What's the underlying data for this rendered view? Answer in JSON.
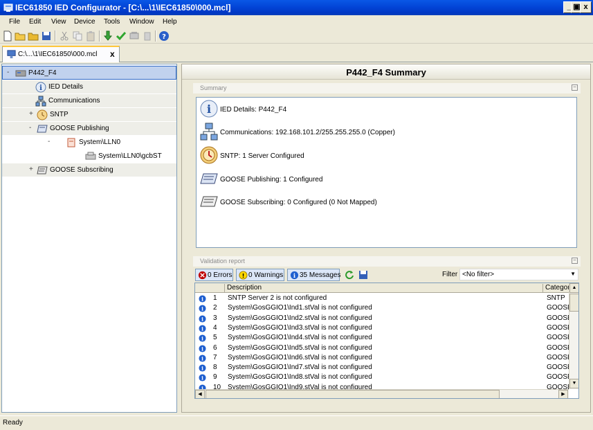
{
  "window": {
    "title": "IEC61850 IED Configurator - [C:\\...\\1\\IEC61850\\000.mcl]",
    "minimize": "_",
    "maximize": "ё",
    "close": "x"
  },
  "menu": [
    "File",
    "Edit",
    "View",
    "Device",
    "Tools",
    "Window",
    "Help"
  ],
  "toolbar_icons": [
    "new-icon",
    "open-icon",
    "folder-icon",
    "save-icon",
    "cut-icon",
    "copy-icon",
    "paste-icon",
    "download-icon",
    "check-icon",
    "send-icon",
    "receive-icon",
    "help-icon"
  ],
  "document_tab": {
    "label": "C:\\...\\1\\IEC61850\\000.mcl",
    "close": "x"
  },
  "tree": {
    "items": [
      {
        "label": "P442_F4",
        "expander": "-",
        "icon": "ied-icon"
      },
      {
        "label": "IED Details",
        "expander": "",
        "icon": "info-icon"
      },
      {
        "label": "Communications",
        "expander": "",
        "icon": "network-icon"
      },
      {
        "label": "SNTP",
        "expander": "+",
        "icon": "clock-icon"
      },
      {
        "label": "GOOSE Publishing",
        "expander": "-",
        "icon": "goose-pub-icon"
      },
      {
        "label": "System\\LLN0",
        "expander": "-",
        "icon": "dataset-icon"
      },
      {
        "label": "System\\LLN0\\gcbST",
        "expander": "",
        "icon": "gcb-icon"
      },
      {
        "label": "GOOSE Subscribing",
        "expander": "+",
        "icon": "goose-sub-icon"
      }
    ]
  },
  "summary": {
    "title": "P442_F4 Summary",
    "group_label": "Summary",
    "collapse": "−",
    "rows": [
      {
        "text": "IED Details: P442_F4",
        "icon": "info-icon"
      },
      {
        "text": "Communications: 192.168.101.2/255.255.255.0 (Copper)",
        "icon": "network-icon"
      },
      {
        "text": "SNTP: 1 Server Configured",
        "icon": "clock-icon"
      },
      {
        "text": "GOOSE Publishing: 1 Configured",
        "icon": "goose-pub-icon"
      },
      {
        "text": "GOOSE Subscribing: 0 Configured (0 Not Mapped)",
        "icon": "goose-sub-icon"
      }
    ]
  },
  "validation": {
    "group_label": "Validation report",
    "collapse": "−",
    "errors_label": "0 Errors",
    "warnings_label": "0 Warnings",
    "messages_label": "35 Messages",
    "filter_label": "Filter",
    "filter_value": "<No filter>",
    "columns": {
      "description": "Description",
      "category": "Categor"
    },
    "rows": [
      {
        "num": "1",
        "desc": "SNTP Server 2 is not configured",
        "cat": "SNTP"
      },
      {
        "num": "2",
        "desc": "System\\GosGGIO1\\Ind1.stVal is not configured",
        "cat": "GOOSE"
      },
      {
        "num": "3",
        "desc": "System\\GosGGIO1\\Ind2.stVal is not configured",
        "cat": "GOOSE"
      },
      {
        "num": "4",
        "desc": "System\\GosGGIO1\\Ind3.stVal is not configured",
        "cat": "GOOSE"
      },
      {
        "num": "5",
        "desc": "System\\GosGGIO1\\Ind4.stVal is not configured",
        "cat": "GOOSE"
      },
      {
        "num": "6",
        "desc": "System\\GosGGIO1\\Ind5.stVal is not configured",
        "cat": "GOOSE"
      },
      {
        "num": "7",
        "desc": "System\\GosGGIO1\\Ind6.stVal is not configured",
        "cat": "GOOSE"
      },
      {
        "num": "8",
        "desc": "System\\GosGGIO1\\Ind7.stVal is not configured",
        "cat": "GOOSE"
      },
      {
        "num": "9",
        "desc": "System\\GosGGIO1\\Ind8.stVal is not configured",
        "cat": "GOOSE"
      },
      {
        "num": "10",
        "desc": "System\\GosGGIO1\\Ind9.stVal is not configured",
        "cat": "GOOSE"
      }
    ]
  },
  "status": {
    "text": "Ready"
  },
  "colors": {
    "titlebar": "#0a58e6",
    "selection": "#c1d2ee",
    "info_blue": "#1f5fd0",
    "error_red": "#c00000",
    "warning_yellow": "#ffd800"
  }
}
